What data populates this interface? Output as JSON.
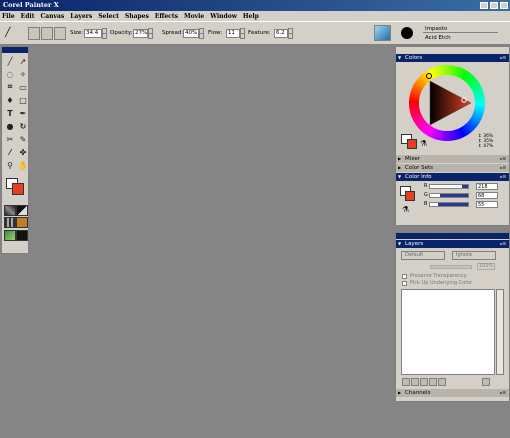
{
  "app": {
    "title": "Corel Painter X"
  },
  "menu": [
    "File",
    "Edit",
    "Canvas",
    "Layers",
    "Select",
    "Shapes",
    "Effects",
    "Movie",
    "Window",
    "Help"
  ],
  "property_bar": {
    "size_label": "Size:",
    "size_value": "34.4",
    "opacity_label": "Opacity:",
    "opacity_value": "27%",
    "spread_label": "Spread:",
    "spread_value": "40%",
    "flow_label": "Flow:",
    "flow_value": "11",
    "feature_label": "Feature:",
    "feature_value": "6.2"
  },
  "brush_selector": {
    "category": "Impasto",
    "variant": "Acid Etch"
  },
  "colors_panel": {
    "title": "Colors",
    "readout": [
      "↕ 36%",
      "↕ 35%",
      "↕ 47%"
    ],
    "hue_indicator_color": "#e24020",
    "main_color": "#e24020",
    "additional_color": "#ffffff"
  },
  "collapsed_panels": {
    "mixer": "Mixer",
    "color_sets": "Color Sets"
  },
  "color_info": {
    "title": "Color Info",
    "channels": [
      {
        "label": "R",
        "value": "218"
      },
      {
        "label": "G",
        "value": "68"
      },
      {
        "label": "B",
        "value": "55"
      }
    ],
    "channel_levels": [
      0.85,
      0.27,
      0.22
    ]
  },
  "layers_panel": {
    "title": "Layers",
    "composite_method": "Default",
    "composite_depth": "Ignore",
    "opacity_value": "100%",
    "preserve_transparency": "Preserve Transparency",
    "pick_up_underlying": "Pick Up Underlying Color"
  },
  "channels_panel": {
    "title": "Channels"
  }
}
